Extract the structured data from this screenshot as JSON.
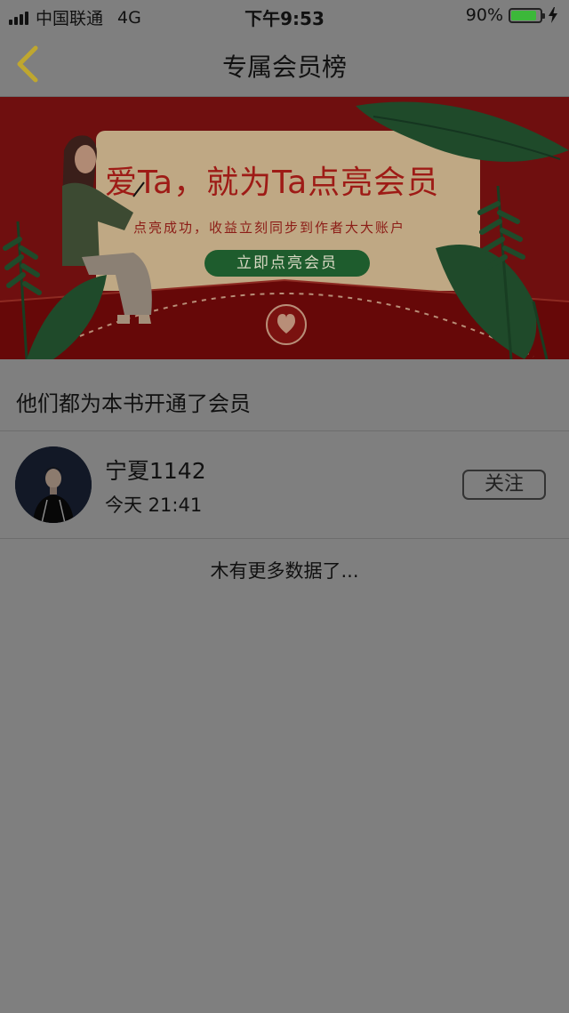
{
  "status_bar": {
    "carrier": "中国联通",
    "network": "4G",
    "time": "下午9:53",
    "battery": "90%",
    "battery_level": 0.9,
    "battery_color": "#3cb83a"
  },
  "nav": {
    "title": "专属会员榜",
    "back_icon": "chevron-left-icon",
    "back_color": "#bfa72f"
  },
  "banner": {
    "headline": "爱Ta，就为Ta点亮会员",
    "subline": "点亮成功，收益立刻同步到作者大大账户",
    "cta": "立即点亮会员"
  },
  "section": {
    "title": "他们都为本书开通了会员"
  },
  "members": [
    {
      "name": "宁夏1142",
      "time": "今天 21:41",
      "follow_label": "关注"
    }
  ],
  "footer": {
    "no_more": "木有更多数据了..."
  }
}
